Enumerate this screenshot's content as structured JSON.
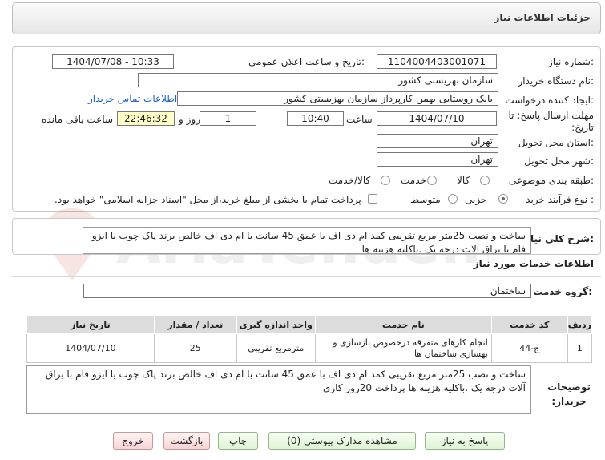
{
  "header": {
    "title": "جزئیات اطلاعات نیاز"
  },
  "fields": {
    "need_number_label": "شماره نیاز:",
    "need_number": "1104004403001071",
    "announce_label": "تاریخ و ساعت اعلان عمومی:",
    "announce_value": "1404/07/08 - 10:33",
    "buyer_org_label": "نام دستگاه خریدار:",
    "buyer_org": "سازمان بهزیستی کشور",
    "creator_label": "ایجاد کننده درخواست:",
    "creator": "بابک  روستایی بهمن کارپرداز سازمان بهزیستی کشور",
    "contact_link": "اطلاعات تماس خریدار",
    "deadline_label": "مهلت ارسال پاسخ: تا تاریخ:",
    "deadline_date": "1404/07/10",
    "hour_label": "ساعت",
    "deadline_time": "10:40",
    "days": "1",
    "days_label": "روز و",
    "remaining": "22:46:32",
    "remaining_label": "ساعت باقی مانده",
    "province_label": "استان محل تحویل:",
    "province": "تهران",
    "city_label": "شهر محل تحویل:",
    "city": "تهران",
    "category_label": "طبقه بندی موضوعی:",
    "category_options": [
      "کالا",
      "خدمت",
      "کالا/خدمت"
    ],
    "process_label": "نوع فرآیند خرید :",
    "process_options": [
      "جزیی",
      "متوسط"
    ],
    "payment_note": "پرداخت تمام یا بخشی از مبلغ خرید،از محل \"اسناد خزانه اسلامی\" خواهد بود."
  },
  "description": {
    "label": "شرح کلی نیاز:",
    "text": "ساخت و نصب 25متر مربع تقریبی کمد ام دی اف با عمق 45 سانت با ام دی اف خالص برند پاک چوب یا ایزو فام با یراق آلات درجه یک .باکلیه هزینه ها"
  },
  "services": {
    "section_title": "اطلاعات خدمات مورد نیاز",
    "group_label": "گروه خدمت:",
    "group_value": "ساختمان",
    "columns": [
      "ردیف",
      "کد خدمت",
      "نام خدمت",
      "واحد اندازه گیری",
      "تعداد / مقدار",
      "تاریخ نیاز"
    ],
    "rows": [
      {
        "idx": "1",
        "code": "ج-44",
        "name": "انجام کارهای متفرقه درخصوص بازسازی و بهسازی ساختمان ها",
        "unit": "مترمربع تقریبی",
        "qty": "25",
        "date": "1404/07/10"
      }
    ]
  },
  "buyer_notes": {
    "label": "توضیحات خریدار:",
    "text": "ساخت و نصب 25متر مربع تقریبی کمد ام دی اف با عمق 45 سانت با ام دی اف خالص برند پاک چوب یا ایزو فام با یراق آلات درجه یک .باکلیه هزینه ها پرداخت 20روز کاری"
  },
  "buttons": {
    "reply": "پاسخ به نیاز",
    "attachments": "مشاهده مدارک پیوستی (0)",
    "print": "چاپ",
    "back": "بازگشت",
    "exit": "خروج"
  },
  "watermark": {
    "text": "AriaTender.net"
  }
}
